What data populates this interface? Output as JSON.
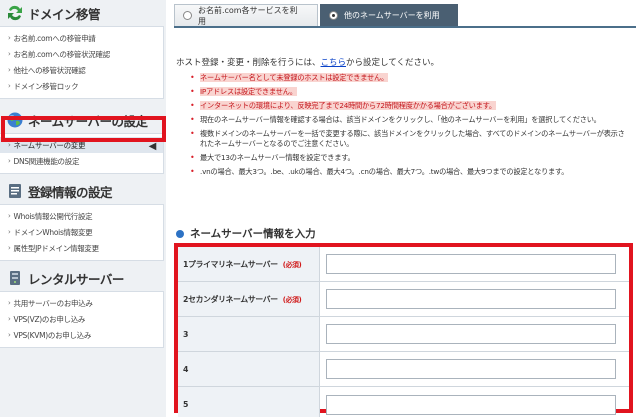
{
  "sidebar": {
    "sections": [
      {
        "title": "ドメイン移管",
        "icon": "domain-transfer-icon",
        "items": [
          "お名前.comへの移管申請",
          "お名前.comへの移管状況確認",
          "他社への移管状況確認",
          "ドメイン移管ロック"
        ]
      },
      {
        "title": "ネームサーバーの設定",
        "icon": "globe-icon",
        "items": [
          "ネームサーバーの変更",
          "DNS関連機能の設定"
        ],
        "active_index": 0
      },
      {
        "title": "登録情報の設定",
        "icon": "registration-icon",
        "items": [
          "Whois情報公開代行設定",
          "ドメインWhois情報変更",
          "属性型JPドメイン情報変更"
        ]
      },
      {
        "title": "レンタルサーバー",
        "icon": "server-icon",
        "items": [
          "共用サーバーのお申込み",
          "VPS(VZ)のお申し込み",
          "VPS(KVM)のお申し込み"
        ]
      }
    ]
  },
  "tabs": [
    {
      "label": "お名前.com各サービスを利用",
      "selected": false
    },
    {
      "label": "他のネームサーバーを利用",
      "selected": true
    }
  ],
  "intro": {
    "before": "ホスト登録・変更・削除を行うには、",
    "link": "こちら",
    "after": "から設定してください。"
  },
  "notes": [
    {
      "text": "ネームサーバー名として未登録のホストは設定できません。",
      "highlight": true
    },
    {
      "text": "IPアドレスは設定できません。",
      "highlight": true
    },
    {
      "text": "インターネットの環境により、反映完了まで24時間から72時間程度かかる場合がございます。",
      "highlight": true
    },
    {
      "text": "現在のネームサーバー情報を確認する場合は、該当ドメインをクリックし、「他のネームサーバーを利用」を選択してください。",
      "highlight": false
    },
    {
      "text": "複数ドメインのネームサーバーを一括で変更する際に、該当ドメインをクリックした場合、すべてのドメインのネームサーバーが表示されたネームサーバーとなるのでご注意ください。",
      "highlight": false
    },
    {
      "text": "最大で13のネームサーバー情報を設定できます。",
      "highlight": false
    },
    {
      "text": ".vnの場合、最大3つ。.be、.ukの場合、最大4つ。.cnの場合、最大7つ。.twの場合、最大9つまでの設定となります。",
      "highlight": false
    }
  ],
  "form": {
    "heading": "ネームサーバー情報を入力",
    "rows": [
      {
        "label": "1プライマリネームサーバー",
        "required": "(必須)",
        "value": ""
      },
      {
        "label": "2セカンダリネームサーバー",
        "required": "(必須)",
        "value": ""
      },
      {
        "label": "3",
        "required": "",
        "value": ""
      },
      {
        "label": "4",
        "required": "",
        "value": ""
      },
      {
        "label": "5",
        "required": "",
        "value": ""
      }
    ]
  },
  "colors": {
    "highlight_border": "#e1141f",
    "active_tab": "#4a5f72",
    "link": "#0a42c8",
    "note_red": "#c4161c"
  }
}
